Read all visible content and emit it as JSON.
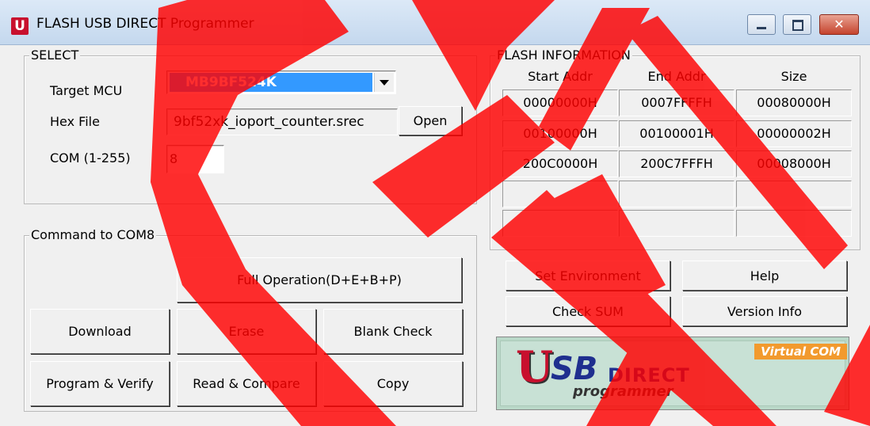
{
  "window": {
    "title": "FLASH USB DIRECT Programmer",
    "icon": "u-app-icon",
    "close_glyph": "✕"
  },
  "select": {
    "legend": "SELECT",
    "target_mcu_label": "Target MCU",
    "target_mcu_value": "MB9BF524K",
    "hex_file_label": "Hex File",
    "hex_file_value": "9bf52xk_ioport_counter.srec",
    "open_label": "Open",
    "com_label": "COM (1-255)",
    "com_value": "8"
  },
  "flash_info": {
    "legend": "FLASH INFORMATION",
    "headers": [
      "Start Addr",
      "End Addr",
      "Size"
    ],
    "rows": [
      [
        "00000000H",
        "0007FFFFH",
        "00080000H"
      ],
      [
        "00100000H",
        "00100001H",
        "00000002H"
      ],
      [
        "200C0000H",
        "200C7FFFH",
        "00008000H"
      ],
      [
        "",
        "",
        ""
      ],
      [
        "",
        "",
        ""
      ]
    ]
  },
  "command": {
    "legend": "Command to COM8",
    "full_operation": "Full Operation(D+E+B+P)",
    "download": "Download",
    "erase": "Erase",
    "blank_check": "Blank Check",
    "program_verify": "Program & Verify",
    "read_compare": "Read & Compare",
    "copy": "Copy"
  },
  "tools": {
    "set_environment": "Set Environment",
    "help": "Help",
    "check_sum": "Check SUM",
    "version_info": "Version Info"
  },
  "logo": {
    "u": "U",
    "sb": "SB",
    "direct": "DIRECT",
    "programmer": "programmer",
    "virtual_com": "Virtual COM"
  },
  "colors": {
    "selection": "#3399ff",
    "watermark": "#ff0000",
    "logo_bg": "#c8e1d5"
  }
}
